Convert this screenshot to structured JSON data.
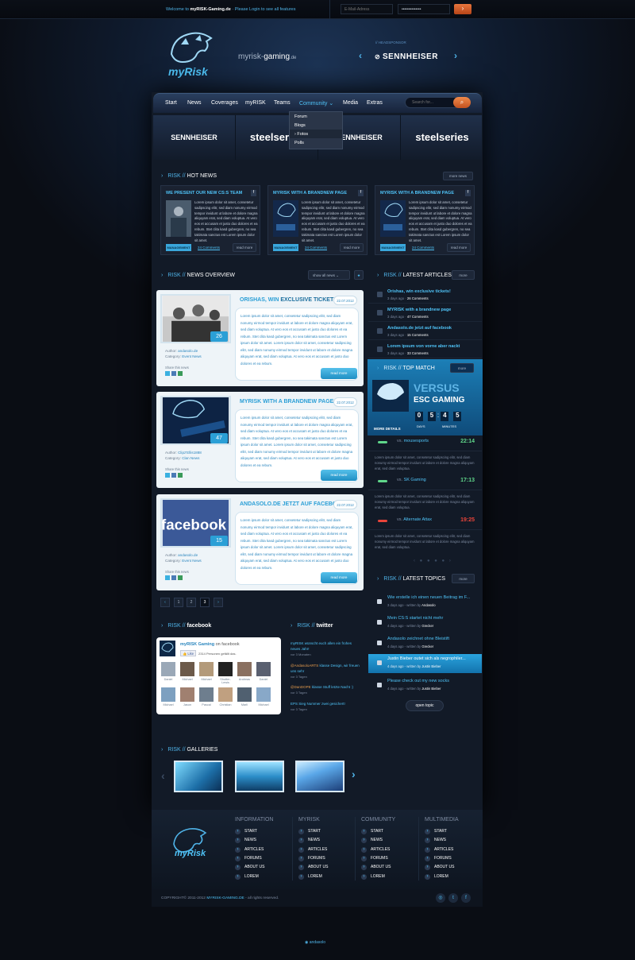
{
  "topbar": {
    "welcome_pre": "Welcome to ",
    "site": "myRISK-Gaming.de",
    "welcome_post": " · Please Login to see all features",
    "email_placeholder": "E-Mail-Adress",
    "password_mask": "••••••••••••••"
  },
  "header": {
    "logo_text": "myRisk",
    "site_name_pre": "myrisk-",
    "site_name_bold": "gaming",
    "site_name_post": ".de",
    "sponsor_label": "// HEADSPONSOR",
    "sponsor_name": "SENNHEISER"
  },
  "nav": {
    "items": [
      "Start",
      "News",
      "Coverages",
      "myRISK",
      "Teams",
      "Community",
      "Media",
      "Extras"
    ],
    "search_placeholder": "Search for...",
    "dropdown": [
      "Forum",
      "Blogs",
      "Fotos",
      "Polls"
    ]
  },
  "sponsors": [
    "SENNHEISER",
    "steelseries",
    "SENNHEISER",
    "steelseries"
  ],
  "hot_news": {
    "title_pre": "RISK //",
    "title": "HOT NEWS",
    "more": "more news",
    "cards": [
      {
        "title": "WE PRESENT OUR NEW CS:S TEAM",
        "text": "Lorem ipsum dolor sit amet, consetetur sadipscing elitr, sed diam nonumy eirmod tempor invidunt ut labore et dolore magna aliquyam erat, sed diam voluptua. At vero eos et accusam et justo duo dolores et ea rebum. Stet clita kasd gubergren, no sea takimata sanctus est Lorem ipsum dolor sit amet.",
        "category": "MANAGEMENT",
        "comments": "24 Comments",
        "read": "read more"
      },
      {
        "title": "MYRISK WITH A BRANDNEW PAGE",
        "text": "Lorem ipsum dolor sit amet, consetetur sadipscing elitr, sed diam nonumy eirmod tempor invidunt ut labore et dolore magna aliquyam erat, sed diam voluptua. At vero eos et accusam et justo duo dolores et ea rebum. Stet clita kasd gubergren, no sea takimata sanctus est Lorem ipsum dolor sit amet.",
        "category": "MANAGEMENT",
        "comments": "24 Comments",
        "read": "read more"
      },
      {
        "title": "MYRISK WITH A BRANDNEW PAGE",
        "text": "Lorem ipsum dolor sit amet, consetetur sadipscing elitr, sed diam nonumy eirmod tempor invidunt ut labore et dolore magna aliquyam erat, sed diam voluptua. At vero eos et accusam et justo duo dolores et ea rebum. Stet clita kasd gubergren, no sea takimata sanctus est Lorem ipsum dolor sit amet.",
        "category": "MANAGEMENT",
        "comments": "24 Comments",
        "read": "read more"
      }
    ]
  },
  "news": {
    "title_pre": "RISK //",
    "title": "NEWS OVERVIEW",
    "filter": "show all news",
    "items": [
      {
        "title_a": "ORISHAS, WIN ",
        "title_b": "EXCLUSIVE TICKETS!",
        "date": "22.07.2012",
        "count": "26",
        "author_label": "Author: ",
        "author": "andasolo.de",
        "category_label": "Category: ",
        "category": "Event News",
        "share": "Share this news",
        "text": "Lorem ipsum dolor sit amet, consetetur sadipscing elitr, sed diam nonumy eirmod tempor invidunt ut labore et dolore magna aliquyam erat, sed diam voluptua. At vero eos et accusam et justo duo dolores et ea rebum. Stet clita kasd gubergren, no sea takimata sanctus est Lorem ipsum dolor sit amet. Lorem ipsum dolor sit amet, consetetur sadipscing elitr, sed diam nonumy eirmod tempor invidunt ut labore et dolore magna aliquyam erat, sed diam voluptua. At vero eos et accusam et justo duo dolores et ea rebum.",
        "read": "read more"
      },
      {
        "title_a": "MYRISK WITH A BRANDNEW PAGE",
        "title_b": "",
        "date": "22.07.2012",
        "count": "47",
        "author_label": "Author: ",
        "author": "Clipz'Ellis1888",
        "category_label": "Category: ",
        "category": "Clan News",
        "share": "Share this news",
        "text": "Lorem ipsum dolor sit amet, consetetur sadipscing elitr, sed diam nonumy eirmod tempor invidunt ut labore et dolore magna aliquyam erat, sed diam voluptua. At vero eos et accusam et justo duo dolores et ea rebum. Stet clita kasd gubergren, no sea takimata sanctus est Lorem ipsum dolor sit amet. Lorem ipsum dolor sit amet, consetetur sadipscing elitr, sed diam nonumy eirmod tempor invidunt ut labore et dolore magna aliquyam erat, sed diam voluptua. At vero eos et accusam et justo duo dolores et ea rebum.",
        "read": "read more"
      },
      {
        "title_a": "ANDASOLO.DE JETZT AUF FACEBOOK",
        "title_b": "",
        "date": "22.07.2012",
        "count": "15",
        "author_label": "Author: ",
        "author": "andasolo.de",
        "category_label": "Category: ",
        "category": "Event News",
        "share": "Share this news",
        "text": "Lorem ipsum dolor sit amet, consetetur sadipscing elitr, sed diam nonumy eirmod tempor invidunt ut labore et dolore magna aliquyam erat, sed diam voluptua. At vero eos et accusam et justo duo dolores et ea rebum. Stet clita kasd gubergren, no sea takimata sanctus est Lorem ipsum dolor sit amet. Lorem ipsum dolor sit amet, consetetur sadipscing elitr, sed diam nonumy eirmod tempor invidunt ut labore et dolore magna aliquyam erat, sed diam voluptua. At vero eos et accusam et justo duo dolores et ea rebum.",
        "read": "read more"
      }
    ],
    "pages": [
      "1",
      "2",
      "3"
    ]
  },
  "articles": {
    "title_pre": "RISK //",
    "title": "LATEST ARTICLES",
    "more": "more",
    "items": [
      {
        "t": "Orishas, win exclusive tickets!",
        "age": "3 days ago",
        "c": "26 Comments"
      },
      {
        "t": "MYRISK with a brandnew page",
        "age": "3 days ago",
        "c": "47 Comments"
      },
      {
        "t": "Andasolo.de jetzt auf facebook",
        "age": "3 days ago",
        "c": "15 Comments"
      },
      {
        "t": "Lorem ipsum von vorne aber nackt",
        "age": "3 days ago",
        "c": "33 Comments"
      }
    ]
  },
  "topmatch": {
    "title_pre": "RISK //",
    "title": "TOP MATCH",
    "more": "more",
    "versus": "VERSUS",
    "team": "ESC GAMING",
    "countdown": [
      "0",
      "5",
      "4",
      "5"
    ],
    "days": "DAYS",
    "minutes": "MINUTES",
    "details": "MORE DETAILS"
  },
  "matches": [
    {
      "opp": "mousesports",
      "score": "22:14",
      "color": "#5fd68a",
      "text": "Lorem ipsum dolor sit amet, consetetur sadipscing elitr, sed diam nonumy eirmod tempor invidunt ut labore et dolore magna aliquyam erat, sed diam voluptua."
    },
    {
      "opp": "SK Gaming",
      "score": "17:13",
      "color": "#5fd68a",
      "text": "Lorem ipsum dolor sit amet, consetetur sadipscing elitr, sed diam nonumy eirmod tempor invidunt ut labore et dolore magna aliquyam erat, sed diam voluptua."
    },
    {
      "opp": "Alternate Attax",
      "score": "19:25",
      "color": "#e8443a",
      "text": "Lorem ipsum dolor sit amet, consetetur sadipscing elitr, sed diam nonumy eirmod tempor invidunt ut labore et dolore magna aliquyam erat, sed diam voluptua."
    }
  ],
  "topics": {
    "title_pre": "RISK //",
    "title": "LATEST TOPICS",
    "more": "more",
    "open": "open topic",
    "items": [
      {
        "t": "Wie erstelle ich einen neuen Beitrag im F...",
        "age": "3 days ago - written by",
        "by": "Andasolo"
      },
      {
        "t": "Mein CS:S startet nicht mehr",
        "age": "4 days ago - written by",
        "by": "Grecker"
      },
      {
        "t": "Andasolo zeichnet ohne Bleistift",
        "age": "4 days ago - written by",
        "by": "Grecker"
      },
      {
        "t": "Justin Bieber outet sich als negrophiler...",
        "age": "4 days ago - written by",
        "by": "Justin Bieber"
      },
      {
        "t": "Please check out my new socks",
        "age": "4 days ago - written by",
        "by": "Justin Bieber"
      }
    ]
  },
  "facebook": {
    "title_pre": "RISK //",
    "title": "facebook",
    "page": "myRISK Gaming",
    "on": " on facebook",
    "like": "Like",
    "likes": "2314 Personen gefällt das.",
    "names": [
      "Daniel",
      "Michael",
      "Michael",
      "Shutter-Lewis",
      "Andreas",
      "Daniel",
      "Michael",
      "Jason",
      "Pascal",
      "Christian",
      "Marli",
      "Michael"
    ]
  },
  "twitter": {
    "title_pre": "RISK //",
    "title": "twitter",
    "tweets": [
      {
        "a": "",
        "text": "myRISK wünscht euch allen ein frohes neues Jahr!",
        "s": "vor 3 Monaten"
      },
      {
        "a": "@AndasoloARTS",
        "text": " klasse Design, wir freuen uns sehr",
        "s": "vor 3 Tagen"
      },
      {
        "a": "@DanDOPE",
        "text": " klasse Stuff letzte Nacht :)",
        "s": "vor 3 Tagen"
      },
      {
        "a": "",
        "text": "EPS Sieg Nummer zwei gesichert!",
        "s": "vor 3 Tagen"
      }
    ]
  },
  "galleries": {
    "title_pre": "RISK //",
    "title": "GALLERIES"
  },
  "footer": {
    "cols": [
      {
        "h": "INFORMATION",
        "links": [
          "START",
          "NEWS",
          "ARTICLES",
          "FORUMS",
          "ABOUT US",
          "LOREM"
        ]
      },
      {
        "h": "MYRISK",
        "links": [
          "START",
          "NEWS",
          "ARTICLES",
          "FORUMS",
          "ABOUT US",
          "LOREM"
        ]
      },
      {
        "h": "COMMUNITY",
        "links": [
          "START",
          "NEWS",
          "ARTICLES",
          "FORUMS",
          "ABOUT US",
          "LOREM"
        ]
      },
      {
        "h": "MULTIMEDIA",
        "links": [
          "START",
          "NEWS",
          "ARTICLES",
          "FORUMS",
          "ABOUT US",
          "LOREM"
        ]
      }
    ],
    "copy_pre": "COPYRIGHT© 2011-2012 ",
    "copy_site": "MYRISK-GAMING.DE",
    "copy_post": " - all rights reserved.",
    "credit": "andasolo"
  }
}
